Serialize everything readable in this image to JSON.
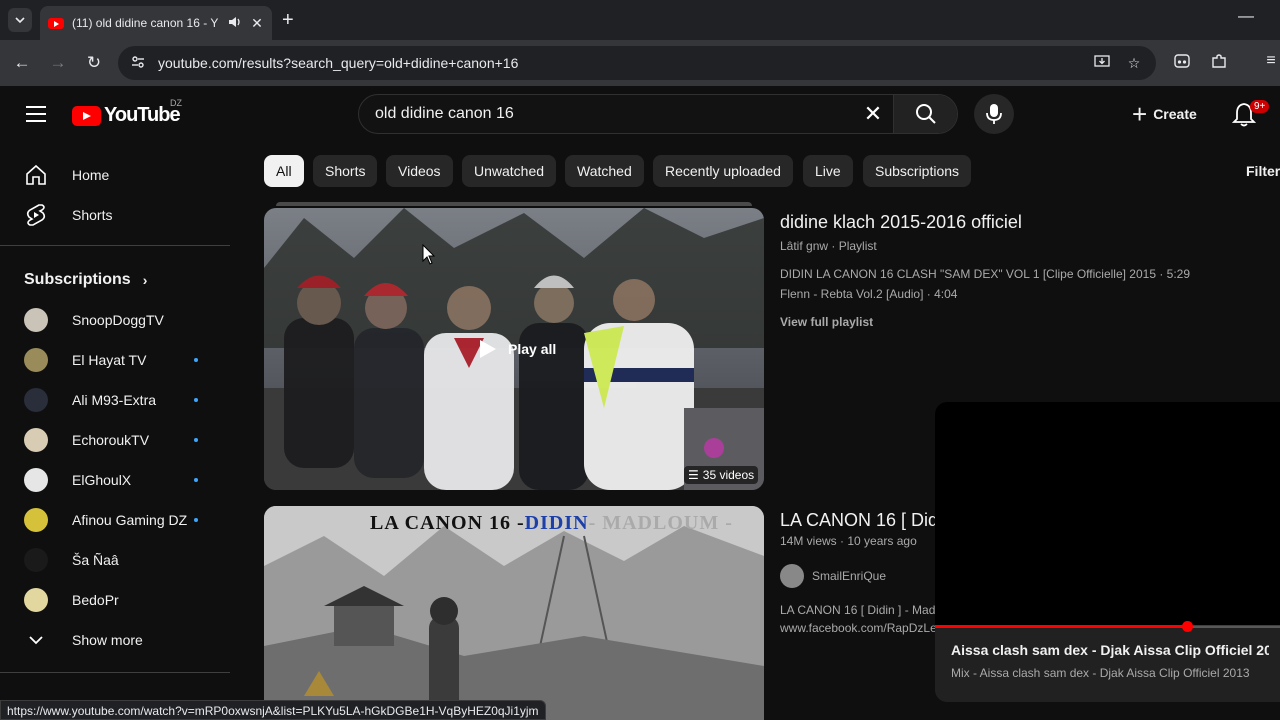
{
  "browser": {
    "tab_title": "(11) old didine canon 16 - Y",
    "url": "youtube.com/results?search_query=old+didine+canon+16",
    "status_url": "https://www.youtube.com/watch?v=mRP0oxwsnjA&list=PLKYu5LA-hGkDGBe1H-VqByHEZ0qJi1yjm"
  },
  "masthead": {
    "logo_text": "YouTube",
    "country": "DZ",
    "search_query": "old didine canon 16",
    "create_label": "Create",
    "notification_count": "9+"
  },
  "sidebar": {
    "main": [
      {
        "label": "Home",
        "icon": "home-icon"
      },
      {
        "label": "Shorts",
        "icon": "shorts-icon"
      }
    ],
    "subscriptions_heading": "Subscriptions",
    "subscriptions": [
      {
        "label": "SnoopDoggTV",
        "color": "#c9c3b8",
        "new": false
      },
      {
        "label": "El Hayat TV",
        "color": "#9a8c5a",
        "new": true
      },
      {
        "label": "Ali M93-Extra",
        "color": "#2a2e3a",
        "new": true
      },
      {
        "label": "EchoroukTV",
        "color": "#d8cdb4",
        "new": true
      },
      {
        "label": "ElGhoulX",
        "color": "#e6e6e6",
        "new": true
      },
      {
        "label": "Afinou Gaming DZ",
        "color": "#d6c23a",
        "new": true
      },
      {
        "label": "Ša Ñaâ",
        "color": "#1a1a1a",
        "new": false
      },
      {
        "label": "BedoPr",
        "color": "#e3d7a0",
        "new": false
      }
    ],
    "show_more": "Show more"
  },
  "chips": [
    "All",
    "Shorts",
    "Videos",
    "Unwatched",
    "Watched",
    "Recently uploaded",
    "Live",
    "Subscriptions"
  ],
  "filters_label": "Filter",
  "results": [
    {
      "title": "didine  klach 2015-2016 officiel",
      "channel": "Lâtif gnw",
      "type": "Playlist",
      "play_all": "Play all",
      "video_count": "35 videos",
      "items": [
        "DIDIN LA CANON 16 CLASH \"SAM DEX\" VOL 1 [Clipe Officielle] 2015 · 5:29",
        "Flenn - Rebta Vol.2 [Audio] · 4:04"
      ],
      "view_full": "View full playlist"
    },
    {
      "title": "LA CANON 16 [ Didi",
      "views": "14M views",
      "age": "10 years ago",
      "channel": "SmailEnriQue",
      "thumb_headline_a": "LA CANON 16 -",
      "thumb_headline_b": "DIDIN",
      "thumb_headline_c": "- MADLOUM -",
      "desc_lines": [
        "LA CANON 16 [ Didin ] - Madl",
        "www.facebook.com/RapDzLe"
      ]
    }
  ],
  "miniplayer": {
    "title": "Aissa clash sam dex - Djak Aissa Clip Officiel 20...",
    "subtitle": "Mix - Aissa clash sam dex - Djak Aissa Clip Officiel 2013",
    "progress": 0.73
  },
  "colors": {
    "brand_red": "#ff0000",
    "background": "#0f0f0f",
    "chip_bg": "#272727",
    "new_dot": "#3ea6ff"
  }
}
